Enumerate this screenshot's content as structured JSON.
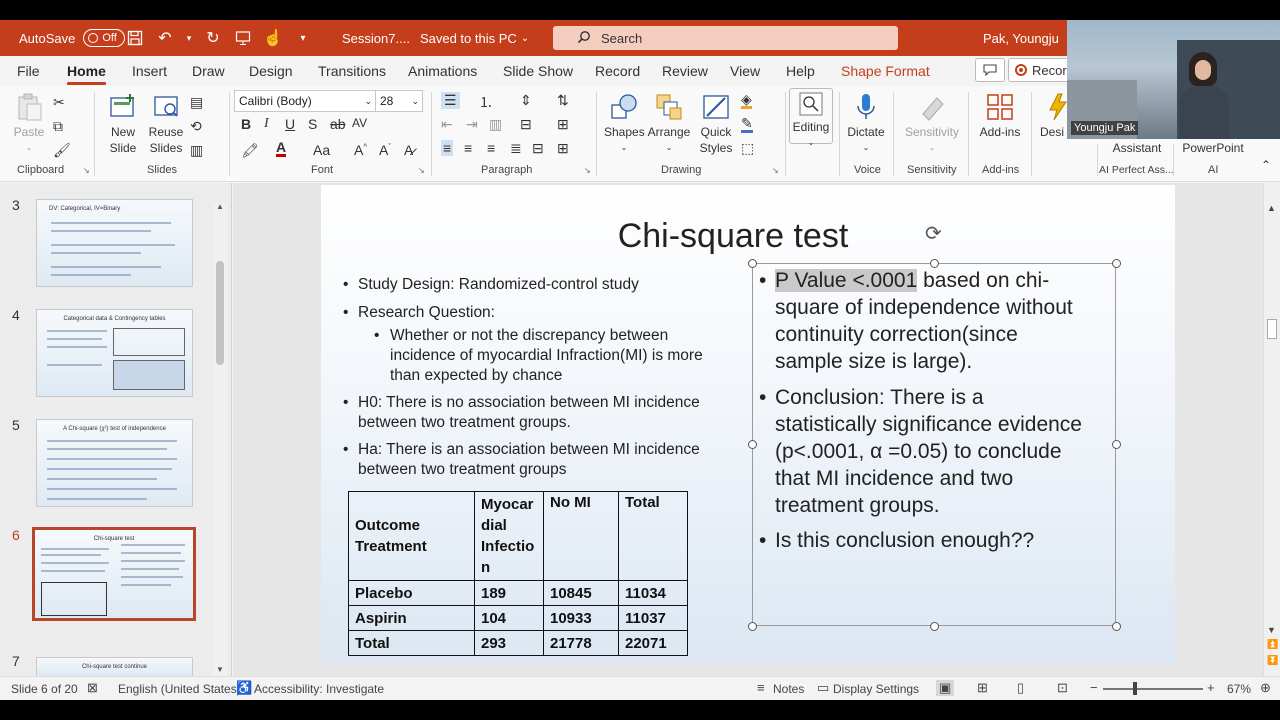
{
  "titlebar": {
    "autosave_label": "AutoSave",
    "autosave_state": "Off",
    "doc_title": "Session7....",
    "save_status": "Saved to this PC",
    "search_placeholder": "Search",
    "user_name": "Pak, Youngju"
  },
  "menu": {
    "tabs": [
      "File",
      "Home",
      "Insert",
      "Draw",
      "Design",
      "Transitions",
      "Animations",
      "Slide Show",
      "Record",
      "Review",
      "View",
      "Help",
      "Shape Format"
    ],
    "active_tab": "Home",
    "record_label": "Recor"
  },
  "ribbon": {
    "clipboard": {
      "paste": "Paste",
      "label": "Clipboard"
    },
    "slides": {
      "new_slide_1": "New",
      "new_slide_2": "Slide",
      "reuse_1": "Reuse",
      "reuse_2": "Slides",
      "label": "Slides"
    },
    "font": {
      "family": "Calibri (Body)",
      "size": "28",
      "label": "Font"
    },
    "paragraph": {
      "label": "Paragraph"
    },
    "drawing": {
      "shapes": "Shapes",
      "arrange": "Arrange",
      "quick_1": "Quick",
      "quick_2": "Styles",
      "label": "Drawing"
    },
    "editing": {
      "label_btn": "Editing"
    },
    "voice": {
      "dictate": "Dictate",
      "label": "Voice"
    },
    "sensitivity": {
      "btn": "Sensitivity",
      "label": "Sensitivity"
    },
    "addins": {
      "btn": "Add-ins",
      "label": "Add-ins"
    },
    "designer": {
      "btn": "Desi"
    },
    "assistant": {
      "btn": "Assistant",
      "label": "AI Perfect Ass..."
    },
    "powerpoint": {
      "btn": "PowerPoint",
      "label": "AI"
    }
  },
  "video": {
    "name": "Youngju Pak"
  },
  "thumbnails": [
    {
      "num": "3",
      "title": "DV: Categorical, IV=Binary"
    },
    {
      "num": "4",
      "title": "Categorical data & Contingency tables"
    },
    {
      "num": "5",
      "title": "A Chi-square (χ²) test of independence"
    },
    {
      "num": "6",
      "title": "Chi-square test"
    },
    {
      "num": "7",
      "title": "Chi-square test continue"
    }
  ],
  "slide": {
    "title": "Chi-square test",
    "left_bullets": {
      "b1": "Study Design: Randomized-control study",
      "b2": "Research Question:",
      "sub1_l1": "Whether or not the discrepancy between",
      "sub1_l2": "incidence of myocardial Infraction(MI) is more",
      "sub1_l3": "than expected by chance",
      "b3_l1": "H0: There is no association between MI incidence",
      "b3_l2": "between two treatment groups.",
      "b4_l1": "Ha: There is an association between MI incidence",
      "b4_l2": "between two treatment groups"
    },
    "table": {
      "header_outcome": "Outcome",
      "header_treatment": "Treatment",
      "header_col1_l1": "Myocar",
      "header_col1_l2": "dial",
      "header_col1_l3": "Infectio",
      "header_col1_l4": "n",
      "header_col2": "No MI",
      "header_col3": "Total",
      "rows": [
        {
          "label": "Placebo",
          "mi": "189",
          "nomi": "10845",
          "total": "11034"
        },
        {
          "label": "Aspirin",
          "mi": "104",
          "nomi": "10933",
          "total": "11037"
        },
        {
          "label": "Total",
          "mi": "293",
          "nomi": "21778",
          "total": "22071"
        }
      ]
    },
    "right_bullets": {
      "p_highlight": "P Value <.0001",
      "p_l1_rest": " based on chi-",
      "p_l2": "square of independence without",
      "p_l3": "continuity correction(since",
      "p_l4": "sample size is large).",
      "c_l1": "Conclusion: There is a",
      "c_l2": "statistically significance evidence",
      "c_l3": "(p<.0001, α =0.05) to conclude",
      "c_l4": "that  MI incidence and two",
      "c_l5": "treatment groups.",
      "q": "Is this conclusion enough??"
    }
  },
  "status": {
    "slide_info": "Slide 6 of 20",
    "language": "English (United States)",
    "accessibility": "Accessibility: Investigate",
    "notes": "Notes",
    "display_settings": "Display Settings",
    "zoom": "67%"
  }
}
